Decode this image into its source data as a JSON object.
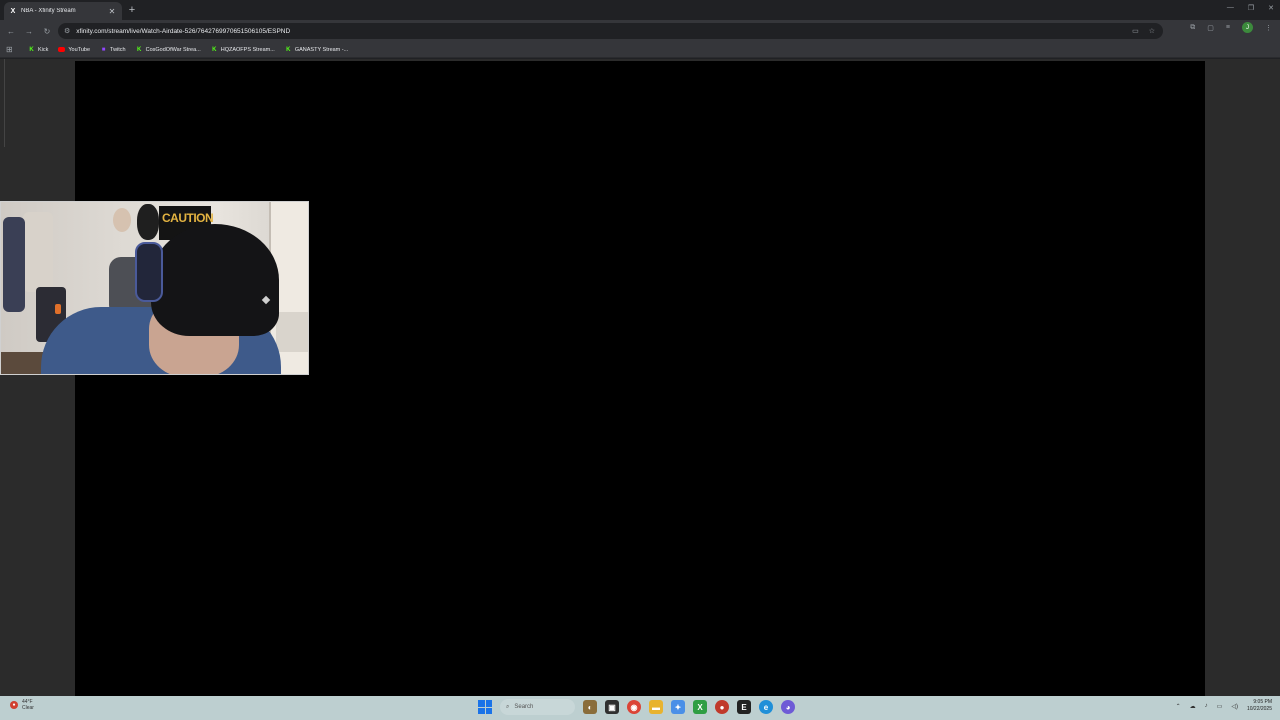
{
  "browser": {
    "tab": {
      "title": "NBA - Xfinity Stream",
      "favicon": "X"
    },
    "new_tab": "+",
    "url": "xfinity.com/stream/live/Watch-Airdate-526/7642769970651506105/ESPND"
  },
  "bookmarks": [
    {
      "label": "Kick",
      "icon": "kick-icon"
    },
    {
      "label": "YouTube",
      "icon": "youtube-icon"
    },
    {
      "label": "Twitch",
      "icon": "twitch-icon"
    },
    {
      "label": "CosGodOfWar Strea...",
      "icon": "kick-icon"
    },
    {
      "label": "HQZAOFPS Stream...",
      "icon": "kick-icon"
    },
    {
      "label": "GANASTY Stream -...",
      "icon": "kick-icon"
    }
  ],
  "webcam": {
    "sign_text": "CAUTION"
  },
  "taskbar": {
    "weather": {
      "temp": "44°F",
      "condition": "Clear"
    },
    "search_placeholder": "Search",
    "clock": {
      "time": "9:05 PM",
      "date": "10/22/2025"
    }
  },
  "colors": {
    "player_bg": "#000000",
    "page_bg": "#2b2b2b",
    "taskbar_bg": "#bdcfd0"
  }
}
